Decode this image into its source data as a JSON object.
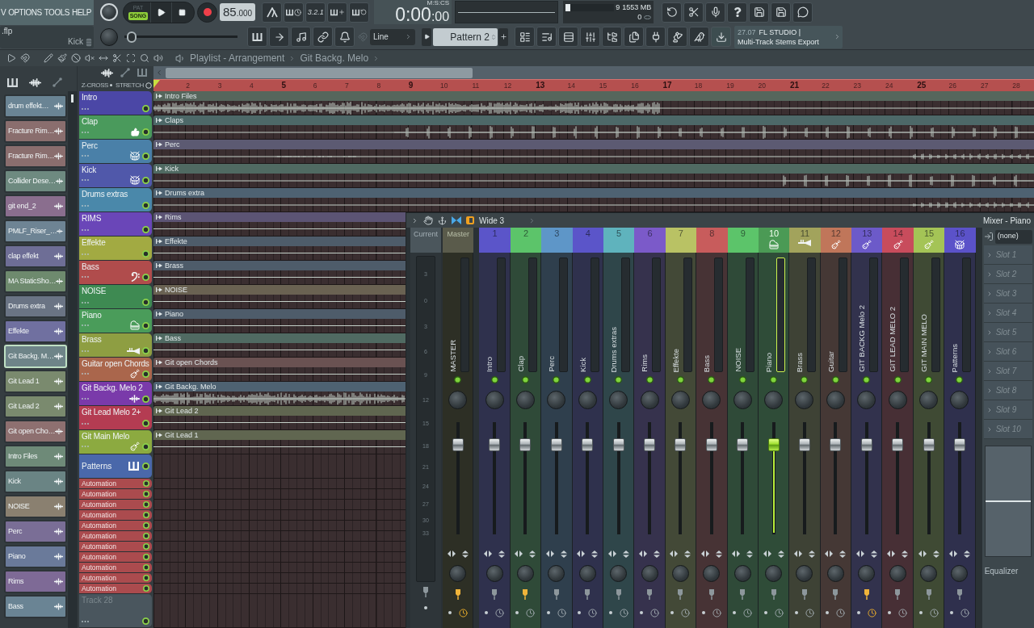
{
  "menu": [
    "V",
    "OPTIONS",
    "TOOLS",
    "HELP"
  ],
  "project": {
    "file": ".flp",
    "channel": "Kick"
  },
  "master_slider": {
    "level": 0.02
  },
  "transport": {
    "modes": [
      {
        "label": "PAT",
        "selected": false
      },
      {
        "label": "SONG",
        "selected": true
      }
    ],
    "tempo": "85",
    "tempo_decimals": ".000",
    "countdown": "3.2.1"
  },
  "clock": {
    "time": "0:00",
    "centiseconds": ":00",
    "format": "M:S:CS"
  },
  "monitor": {
    "cpu": {
      "level": 0.1,
      "reading": "9"
    },
    "memory": "1553 MB",
    "polyphony": "0"
  },
  "snap": "Line",
  "pattern": "Pattern 2",
  "hint": {
    "time": "27.07",
    "title": "FL STUDIO |",
    "text": "Multi-Track Stems Export"
  },
  "browser": {
    "items": [
      {
        "name": "drum effekt…",
        "color": "#6a8494",
        "selected": false
      },
      {
        "name": "Fracture Rim…",
        "color": "#8a6e6e",
        "selected": false
      },
      {
        "name": "Fracture Rim…",
        "color": "#8a6e6e",
        "selected": false
      },
      {
        "name": "Collider Dese…",
        "color": "#6e8a80",
        "selected": false
      },
      {
        "name": "git end_2",
        "color": "#8a6e8e",
        "selected": false
      },
      {
        "name": "PMLF_Riser_…",
        "color": "#6e8494",
        "selected": false
      },
      {
        "name": "clap effekt",
        "color": "#6e6e96",
        "selected": false
      },
      {
        "name": "MA StaticSho…",
        "color": "#6e8a6e",
        "selected": false
      },
      {
        "name": "Drums extra",
        "color": "#6a7484",
        "selected": false
      },
      {
        "name": "Effekte",
        "color": "#7070a0",
        "selected": false
      },
      {
        "name": "Git Backg. M…",
        "color": "#6e8488",
        "selected": true
      },
      {
        "name": "Git Lead 1",
        "color": "#7a8a6e",
        "selected": false
      },
      {
        "name": "Git Lead 2",
        "color": "#7a8a6e",
        "selected": false
      },
      {
        "name": "Git open Cho…",
        "color": "#8e7070",
        "selected": false
      },
      {
        "name": "Intro Files",
        "color": "#6e8a78",
        "selected": false
      },
      {
        "name": "Kick",
        "color": "#6a8484",
        "selected": false
      },
      {
        "name": "NOISE",
        "color": "#8a8070",
        "selected": false
      },
      {
        "name": "Perc",
        "color": "#7a6e96",
        "selected": false
      },
      {
        "name": "Piano",
        "color": "#6a7a9a",
        "selected": false
      },
      {
        "name": "Rims",
        "color": "#7e6a96",
        "selected": false
      },
      {
        "name": "Bass",
        "color": "#6a8494",
        "selected": false
      }
    ]
  },
  "playlist": {
    "breadcrumb": [
      "Playlist - Arrangement",
      "Git Backg. Melo"
    ],
    "crossfade": "Z-CROSS",
    "stretch": "STRETCH",
    "ruler": [
      "2",
      "3",
      "4",
      "5",
      "6",
      "7",
      "8",
      "9",
      "10",
      "11",
      "12",
      "13",
      "14",
      "15",
      "16",
      "17",
      "18",
      "19",
      "20",
      "21",
      "22",
      "23",
      "24",
      "25",
      "26",
      "27",
      "28"
    ],
    "tracks": [
      {
        "name": "Intro",
        "kind": "audio",
        "color": "#4b47a6",
        "clip": {
          "name": "Intro Files",
          "color": "#56665c"
        }
      },
      {
        "name": "Clap",
        "kind": "audio",
        "color": "#4a9a5c",
        "clip": {
          "name": "Claps",
          "color": "#4d6868"
        }
      },
      {
        "name": "Perc",
        "kind": "audio",
        "color": "#4a80a8",
        "clip": {
          "name": "Perc",
          "color": "#5c5a72"
        }
      },
      {
        "name": "Kick",
        "kind": "audio",
        "color": "#5058aa",
        "clip": {
          "name": "Kick",
          "color": "#506a62"
        }
      },
      {
        "name": "Drums extras",
        "kind": "audio",
        "color": "#4a88aa",
        "clip": {
          "name": "Drums extra",
          "color": "#4e6272"
        }
      },
      {
        "name": "RIMS",
        "kind": "audio",
        "color": "#6a46b8",
        "clip": {
          "name": "Rims",
          "color": "#5c5474"
        }
      },
      {
        "name": "Effekte",
        "kind": "audio",
        "color": "#a2aa42",
        "clip": {
          "name": "Effekte",
          "color": "#4e5c6a"
        }
      },
      {
        "name": "Bass",
        "kind": "audio",
        "color": "#b04c4c",
        "clip": {
          "name": "Brass",
          "color": "#4e5c6a"
        }
      },
      {
        "name": "NOISE",
        "kind": "audio",
        "color": "#3e8a52",
        "clip": {
          "name": "NOISE",
          "color": "#6a6252"
        }
      },
      {
        "name": "Piano",
        "kind": "audio",
        "color": "#4a9c5a",
        "clip": {
          "name": "Piano",
          "color": "#4e5c6a"
        }
      },
      {
        "name": "Brass",
        "kind": "audio",
        "color": "#8e9e42",
        "clip": {
          "name": "Bass",
          "color": "#506a62"
        }
      },
      {
        "name": "Guitar open Chords",
        "kind": "audio",
        "color": "#aa664c",
        "clip": {
          "name": "Git open Chords",
          "color": "#6a5252"
        }
      },
      {
        "name": "Git Backg. Melo 2",
        "kind": "audio",
        "color": "#7a3aaa",
        "clip": {
          "name": "Git Backg. Melo",
          "color": "#4e6272"
        }
      },
      {
        "name": "Git Lead Melo 2+",
        "kind": "audio",
        "color": "#b43c52",
        "clip": {
          "name": "Git Lead 2",
          "color": "#606650"
        }
      },
      {
        "name": "Git Main Melo",
        "kind": "audio",
        "color": "#8caa40",
        "clip": {
          "name": "Git Lead 1",
          "color": "#606650"
        }
      },
      {
        "name": "Patterns",
        "kind": "patterns",
        "color": "#4a68aa"
      },
      {
        "name": "Automation",
        "kind": "automation",
        "color": "#ab4b4e"
      },
      {
        "name": "Automation",
        "kind": "automation",
        "color": "#ab4b4e"
      },
      {
        "name": "Automation",
        "kind": "automation",
        "color": "#ab4b4e"
      },
      {
        "name": "Automation",
        "kind": "automation",
        "color": "#ab4b4e"
      },
      {
        "name": "Automation",
        "kind": "automation",
        "color": "#ab4b4e"
      },
      {
        "name": "Automation",
        "kind": "automation",
        "color": "#ab4b4e"
      },
      {
        "name": "Automation",
        "kind": "automation",
        "color": "#ab4b4e"
      },
      {
        "name": "Automation",
        "kind": "automation",
        "color": "#ab4b4e"
      },
      {
        "name": "Automation",
        "kind": "automation",
        "color": "#ab4b4e"
      },
      {
        "name": "Automation",
        "kind": "automation",
        "color": "#ab4b4e"
      },
      {
        "name": "Automation",
        "kind": "automation",
        "color": "#ab4b4e"
      },
      {
        "name": "Track 28",
        "kind": "empty",
        "color": "#4a565e"
      }
    ]
  },
  "mixer": {
    "preset": "Wide 3",
    "title": "Mixer - Piano",
    "current": "Current",
    "scale": [
      "3",
      "0",
      "3",
      "6",
      "9",
      "12",
      "15",
      "18",
      "21",
      "24",
      "27",
      "30",
      "33"
    ],
    "master": {
      "label": "Master",
      "name": "MASTER",
      "level": 0.84,
      "route_on": true,
      "timer_on": true
    },
    "inserts": [
      {
        "number": "1",
        "name": "Intro",
        "color": "#5b55c9",
        "selected": false,
        "level": 0.84,
        "route_on": false,
        "timer_on": false
      },
      {
        "number": "2",
        "name": "Clap",
        "color": "#5cc46a",
        "selected": false,
        "level": 0.84,
        "route_on": true,
        "timer_on": false
      },
      {
        "number": "3",
        "name": "Perc",
        "color": "#5e96c8",
        "selected": false,
        "level": 0.84,
        "route_on": false,
        "timer_on": false
      },
      {
        "number": "4",
        "name": "Kick",
        "color": "#5b55c9",
        "selected": false,
        "level": 0.84,
        "route_on": false,
        "timer_on": false
      },
      {
        "number": "5",
        "name": "Drums extras",
        "color": "#5fb3bd",
        "selected": false,
        "level": 0.84,
        "route_on": false,
        "timer_on": false
      },
      {
        "number": "6",
        "name": "Rims",
        "color": "#7b5ac9",
        "selected": false,
        "level": 0.84,
        "route_on": false,
        "timer_on": false
      },
      {
        "number": "7",
        "name": "Effekte",
        "color": "#b9c264",
        "selected": false,
        "level": 0.84,
        "route_on": false,
        "timer_on": false
      },
      {
        "number": "8",
        "name": "Bass",
        "color": "#c85c5c",
        "selected": false,
        "level": 0.84,
        "route_on": false,
        "timer_on": false
      },
      {
        "number": "9",
        "name": "NOISE",
        "color": "#5cc46a",
        "selected": false,
        "level": 0.84,
        "route_on": false,
        "timer_on": false
      },
      {
        "number": "10",
        "name": "Piano",
        "color": "#4b9a55",
        "selected": true,
        "level": 0.84,
        "route_on": false,
        "timer_on": false
      },
      {
        "number": "11",
        "name": "Brass",
        "color": "#a2a35c",
        "selected": false,
        "level": 0.84,
        "route_on": false,
        "timer_on": false
      },
      {
        "number": "12",
        "name": "Guitar",
        "color": "#c0765a",
        "selected": false,
        "level": 0.84,
        "route_on": false,
        "timer_on": false
      },
      {
        "number": "13",
        "name": "GIT BACKG Melo 2",
        "color": "#6c5ac9",
        "selected": false,
        "level": 0.84,
        "route_on": true,
        "timer_on": true
      },
      {
        "number": "14",
        "name": "GIT LEAD MELO 2",
        "color": "#c84c5c",
        "selected": false,
        "level": 0.84,
        "route_on": false,
        "timer_on": false
      },
      {
        "number": "15",
        "name": "GIT MAIN MELO",
        "color": "#a4c456",
        "selected": false,
        "level": 0.84,
        "route_on": false,
        "timer_on": false
      },
      {
        "number": "16",
        "name": "Patterns",
        "color": "#5b52c9",
        "selected": false,
        "level": 0.84,
        "route_on": false,
        "timer_on": false
      }
    ],
    "input": "(none)",
    "slots": [
      "Slot 1",
      "Slot 2",
      "Slot 3",
      "Slot 4",
      "Slot 5",
      "Slot 6",
      "Slot 7",
      "Slot 8",
      "Slot 9",
      "Slot 10"
    ],
    "effect": "Equalizer"
  }
}
